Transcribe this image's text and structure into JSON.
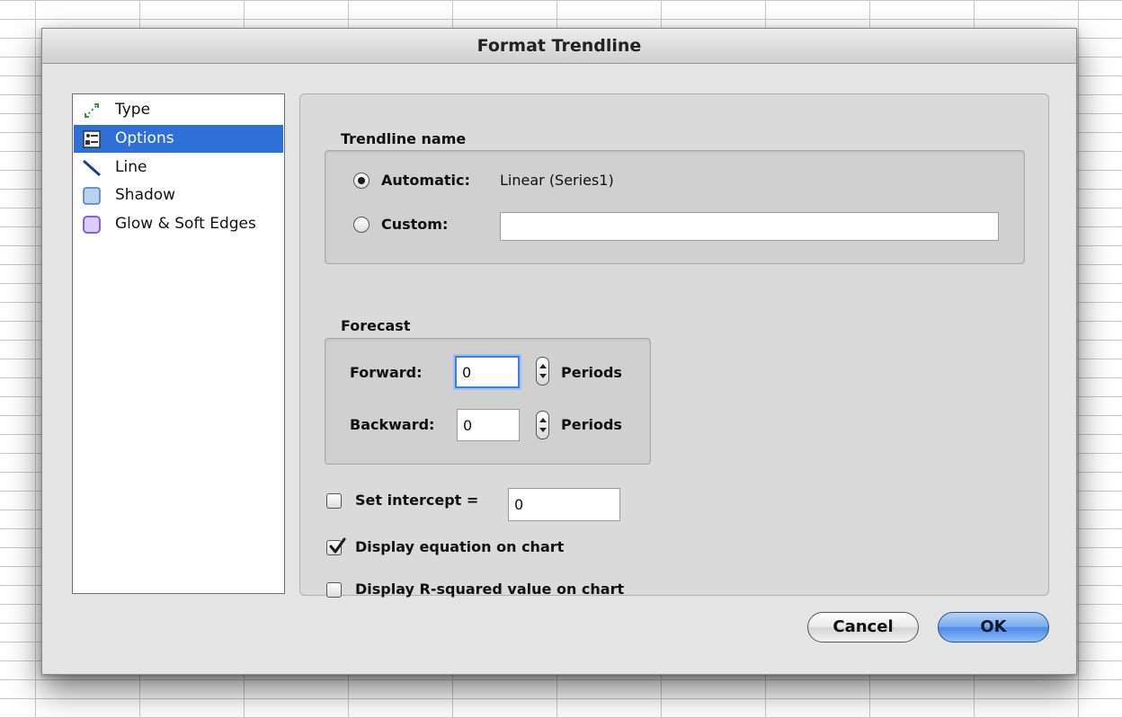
{
  "dialog": {
    "title": "Format Trendline"
  },
  "sidebar": {
    "items": [
      {
        "label": "Type",
        "icon": "trendline-type-icon"
      },
      {
        "label": "Options",
        "icon": "options-icon"
      },
      {
        "label": "Line",
        "icon": "line-icon"
      },
      {
        "label": "Shadow",
        "icon": "shadow-icon"
      },
      {
        "label": "Glow & Soft Edges",
        "icon": "glow-icon"
      }
    ],
    "selected": "Options"
  },
  "trendline_name": {
    "title": "Trendline name",
    "automatic_label": "Automatic:",
    "automatic_value": "Linear (Series1)",
    "custom_label": "Custom:",
    "custom_value": "",
    "selected": "automatic"
  },
  "forecast": {
    "title": "Forecast",
    "forward_label": "Forward:",
    "forward_value": "0",
    "backward_label": "Backward:",
    "backward_value": "0",
    "forward_units": "Periods",
    "backward_units": "Periods"
  },
  "options": {
    "intercept_label": "Set intercept =",
    "intercept_checked": false,
    "intercept_value": "0",
    "equation_label": "Display equation on chart",
    "equation_checked": true,
    "rsquared_label": "Display R-squared value on chart",
    "rsquared_checked": false
  },
  "buttons": {
    "cancel": "Cancel",
    "ok": "OK"
  },
  "colors": {
    "selection": "#2f6fd8",
    "focus": "#3e7fe0",
    "glow_icon": "#a07ee8"
  }
}
